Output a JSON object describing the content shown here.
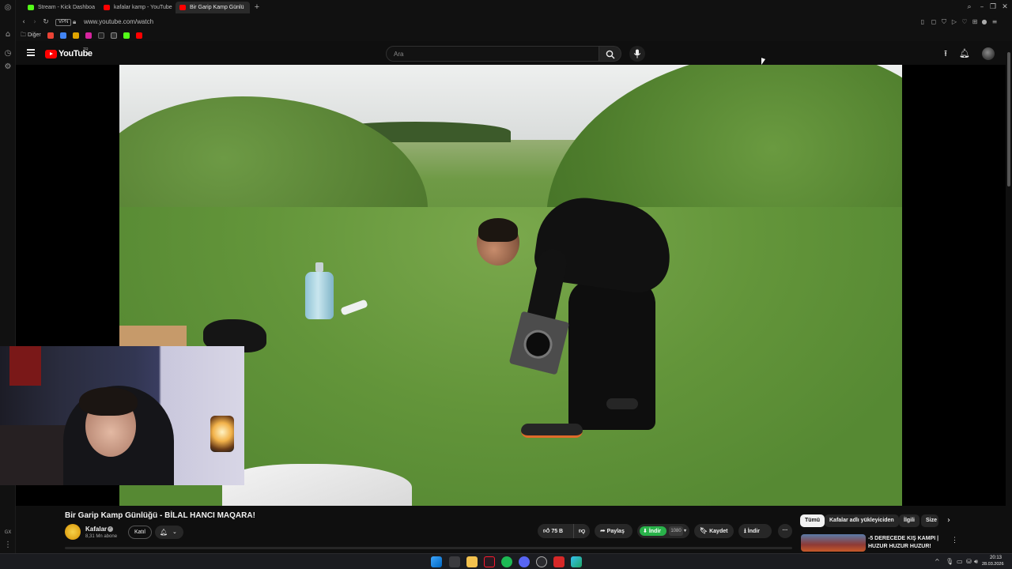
{
  "browser": {
    "tabs": [
      {
        "label": "Stream - Kick Dashboa",
        "favicon_color": "#53fc18"
      },
      {
        "label": "kafalar kamp - YouTube",
        "favicon_color": "#ff0000"
      },
      {
        "label": "Bir Garip Kamp Günlü",
        "favicon_color": "#ff0000"
      }
    ],
    "vpn_label": "VPN",
    "url": "www.youtube.com/watch",
    "bookmark_folder": "Diğer"
  },
  "youtube": {
    "logo_text": "YouTube",
    "country_code": "TR",
    "search_placeholder": "Ara"
  },
  "video": {
    "title": "Bir Garip Kamp Günlüğü - BİLAL HANCI MAQARA!",
    "channel_name": "Kafalar",
    "subscribers": "8,31 Mn abone",
    "join_label": "Katıl",
    "likes": "75 B",
    "share_label": "Paylaş",
    "premium_download_label": "İndir",
    "quality_label": "1080",
    "save_label": "Kaydet",
    "download_label": "İndir",
    "more_label": "···"
  },
  "chips": [
    "Tümü",
    "Kafalar adlı yükleyiciden",
    "İlgili",
    "Size"
  ],
  "recommendation": {
    "title": "-5 DERECEDE KIŞ KAMPI | HUZUR HUZUR HUZUR!"
  },
  "taskbar": {
    "time": "20:13",
    "date": "28.03.2026"
  },
  "colors": {
    "youtube_red": "#ff0000",
    "download_green": "#29b24a",
    "kick_green": "#53fc18"
  },
  "icons": {
    "hamburger": "menu-icon",
    "search": "search-icon",
    "mic": "mic-icon",
    "upload": "upload-icon",
    "notifications": "bell-icon"
  }
}
